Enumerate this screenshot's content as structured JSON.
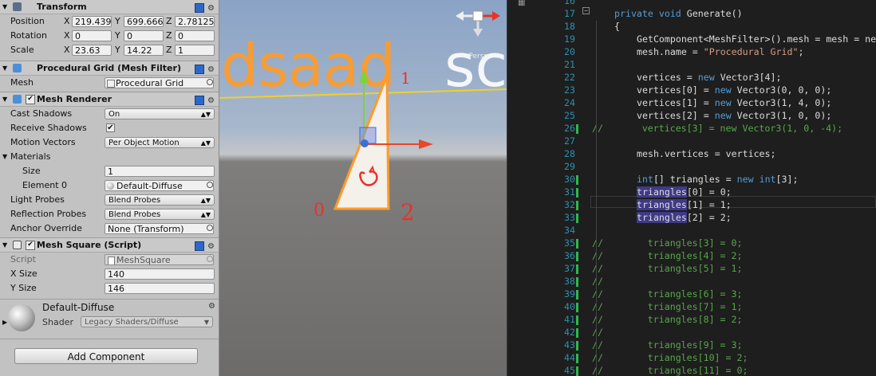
{
  "inspector": {
    "transform": {
      "title": "Transform",
      "position": {
        "label": "Position",
        "x": "219.439",
        "y": "699.666",
        "z": "2.78125"
      },
      "rotation": {
        "label": "Rotation",
        "x": "0",
        "y": "0",
        "z": "0"
      },
      "scale": {
        "label": "Scale",
        "x": "23.63",
        "y": "14.22",
        "z": "1"
      }
    },
    "mesh_filter": {
      "title": "Procedural Grid (Mesh Filter)",
      "mesh_label": "Mesh",
      "mesh_value": "Procedural Grid"
    },
    "mesh_renderer": {
      "title": "Mesh Renderer",
      "cast_shadows": {
        "label": "Cast Shadows",
        "value": "On"
      },
      "receive_shadows": {
        "label": "Receive Shadows",
        "checked": true
      },
      "motion_vectors": {
        "label": "Motion Vectors",
        "value": "Per Object Motion"
      },
      "materials_label": "Materials",
      "size": {
        "label": "Size",
        "value": "1"
      },
      "element0": {
        "label": "Element 0",
        "value": "Default-Diffuse"
      },
      "light_probes": {
        "label": "Light Probes",
        "value": "Blend Probes"
      },
      "reflection_probes": {
        "label": "Reflection Probes",
        "value": "Blend Probes"
      },
      "anchor_override": {
        "label": "Anchor Override",
        "value": "None (Transform)"
      }
    },
    "mesh_square": {
      "title": "Mesh Square (Script)",
      "script": {
        "label": "Script",
        "value": "MeshSquare"
      },
      "x_size": {
        "label": "X Size",
        "value": "140"
      },
      "y_size": {
        "label": "Y Size",
        "value": "146"
      }
    },
    "material": {
      "title": "Default-Diffuse",
      "shader_label": "Shader",
      "shader_value": "Legacy Shaders/Diffuse"
    },
    "add_component": "Add Component"
  },
  "scene": {
    "text_orange": "dsaad",
    "text_white": "sc",
    "persp_label": "< Persp",
    "annotations": {
      "zero": "0",
      "one": "1",
      "two": "2"
    },
    "colors": {
      "orange": "#ff9b2a",
      "red": "#e8322a",
      "axis_red": "#e8472a",
      "axis_green": "#7fd23c",
      "axis_blue": "#3a6fd8"
    }
  },
  "editor": {
    "lines": [
      {
        "n": "16",
        "t": ""
      },
      {
        "n": "17",
        "t": "private void Generate()"
      },
      {
        "n": "18",
        "t": "{"
      },
      {
        "n": "19",
        "t": "GetComponent<MeshFilter>().mesh = mesh = ne"
      },
      {
        "n": "20",
        "t": "mesh.name = \"Procedural Grid\";"
      },
      {
        "n": "21",
        "t": ""
      },
      {
        "n": "22",
        "t": "vertices = new Vector3[4];"
      },
      {
        "n": "23",
        "t": "vertices[0] = new Vector3(0, 0, 0);"
      },
      {
        "n": "24",
        "t": "vertices[1] = new Vector3(1, 4, 0);"
      },
      {
        "n": "25",
        "t": "vertices[2] = new Vector3(1, 0, 0);"
      },
      {
        "n": "26",
        "t": "//       vertices[3] = new Vector3(1, 0, -4);"
      },
      {
        "n": "27",
        "t": ""
      },
      {
        "n": "28",
        "t": "mesh.vertices = vertices;"
      },
      {
        "n": "29",
        "t": ""
      },
      {
        "n": "30",
        "t": "int[] triangles = new int[3];"
      },
      {
        "n": "31",
        "t": "triangles[0] = 0;"
      },
      {
        "n": "32",
        "t": "triangles[1] = 1;"
      },
      {
        "n": "33",
        "t": "triangles[2] = 2;"
      },
      {
        "n": "34",
        "t": ""
      },
      {
        "n": "35",
        "t": "//        triangles[3] = 0;"
      },
      {
        "n": "36",
        "t": "//        triangles[4] = 2;"
      },
      {
        "n": "37",
        "t": "//        triangles[5] = 1;"
      },
      {
        "n": "38",
        "t": "//"
      },
      {
        "n": "39",
        "t": "//        triangles[6] = 3;"
      },
      {
        "n": "40",
        "t": "//        triangles[7] = 1;"
      },
      {
        "n": "41",
        "t": "//        triangles[8] = 2;"
      },
      {
        "n": "42",
        "t": "//"
      },
      {
        "n": "43",
        "t": "//        triangles[9] = 3;"
      },
      {
        "n": "44",
        "t": "//        triangles[10] = 2;"
      },
      {
        "n": "45",
        "t": "//        triangles[11] = 0;"
      }
    ],
    "colors": {
      "keyword": "#569cd6",
      "string": "#d69d85",
      "comment": "#57a64a",
      "linenumber": "#2b91af",
      "change_bar": "#2fb74b"
    }
  }
}
